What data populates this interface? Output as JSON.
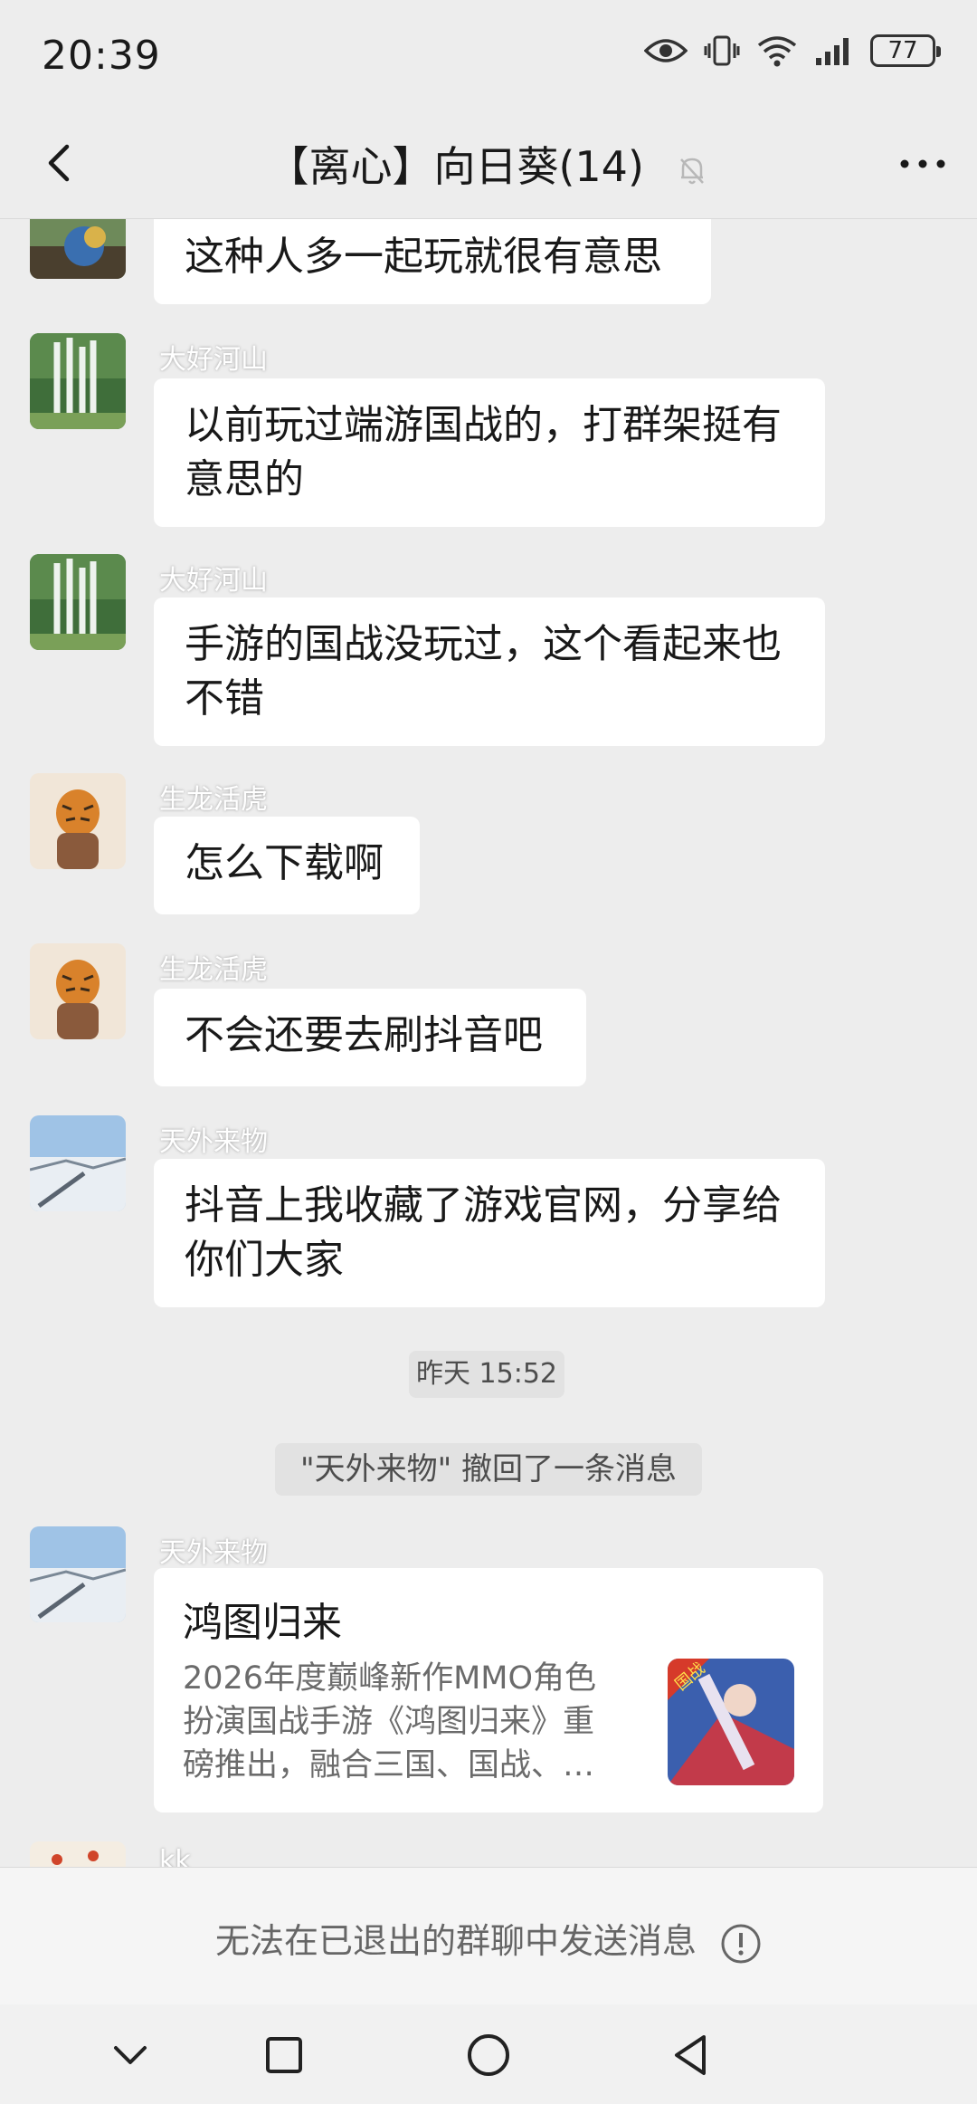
{
  "status_bar": {
    "time": "20:39",
    "battery": "77"
  },
  "header": {
    "title": "【离心】向日葵(14)"
  },
  "messages": [
    {
      "sender": "",
      "text": "这种人多一起玩就很有意思"
    },
    {
      "sender": "大好河山",
      "text": "以前玩过端游国战的，打群架挺有意思的"
    },
    {
      "sender": "大好河山",
      "text": "手游的国战没玩过，这个看起来也不错"
    },
    {
      "sender": "生龙活虎",
      "text": "怎么下载啊"
    },
    {
      "sender": "生龙活虎",
      "text": "不会还要去刷抖音吧"
    },
    {
      "sender": "天外来物",
      "text": "抖音上我收藏了游戏官网，分享给你们大家"
    }
  ],
  "timestamp": "昨天 15:52",
  "system_message": "\"天外来物\" 撤回了一条消息",
  "card_message": {
    "sender": "天外来物",
    "title": "鸿图归来",
    "description": "2026年度巅峰新作MMO角色扮演国战手游《鸿图归来》重磅推出，融合三国、国战、…",
    "thumb_badge": "国战"
  },
  "partial_sender": "kk",
  "bottom_notice": "无法在已退出的群聊中发送消息",
  "colors": {
    "background": "#ededed",
    "bubble": "#ffffff",
    "notice_text": "#666666"
  }
}
